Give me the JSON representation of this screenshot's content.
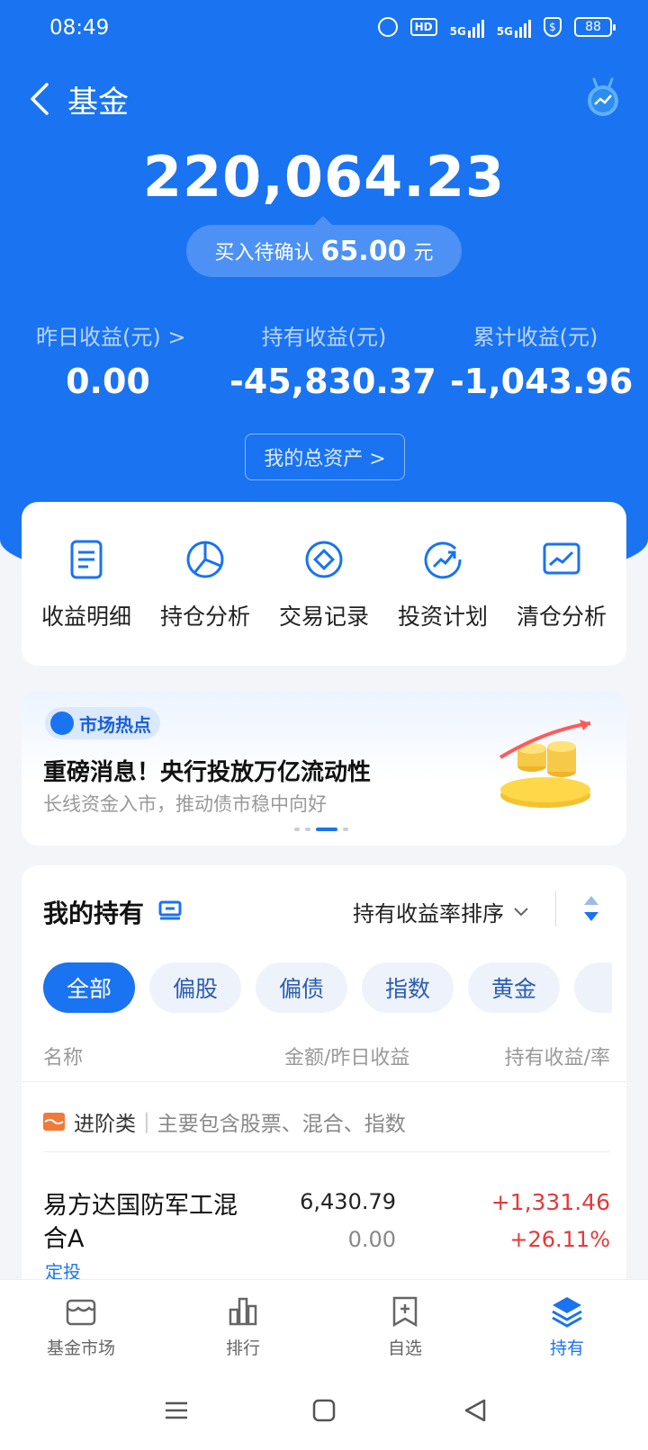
{
  "status_bar": {
    "time": "08:49",
    "network_1": "5G",
    "network_2": "5G",
    "hd_badge": "HD",
    "battery": "88"
  },
  "header": {
    "title": "基金"
  },
  "summary": {
    "total_amount": "220,064.23",
    "pending_label": "买入待确认",
    "pending_value": "65.00",
    "pending_unit": "元",
    "stats": [
      {
        "label": "昨日收益(元) >",
        "value": "0.00"
      },
      {
        "label": "持有收益(元)",
        "value": "-45,830.37"
      },
      {
        "label": "累计收益(元)",
        "value": "-1,043.96"
      }
    ],
    "assets_button": "我的总资产 >"
  },
  "quick_actions": [
    {
      "label": "收益明细",
      "icon": "document-icon"
    },
    {
      "label": "持仓分析",
      "icon": "pie-chart-icon"
    },
    {
      "label": "交易记录",
      "icon": "diamond-circle-icon"
    },
    {
      "label": "投资计划",
      "icon": "trend-circle-icon"
    },
    {
      "label": "清仓分析",
      "icon": "line-chart-icon"
    }
  ],
  "banner": {
    "tag": "市场热点",
    "title": "重磅消息！央行投放万亿流动性",
    "subtitle": "长线资金入市，推动债市稳中向好"
  },
  "holdings": {
    "title": "我的持有",
    "sort_label": "持有收益率排序",
    "filters": [
      "全部",
      "偏股",
      "偏债",
      "指数",
      "黄金",
      ""
    ],
    "active_filter": "全部",
    "columns": {
      "name": "名称",
      "amount": "金额/昨日收益",
      "profit": "持有收益/率"
    },
    "category": {
      "name": "进阶类",
      "desc": "主要包含股票、混合、指数"
    },
    "funds": [
      {
        "name": "易方达国防军工混合A",
        "tag": "定投",
        "amount": "6,430.79",
        "yesterday": "0.00",
        "profit": "+1,331.46",
        "rate": "+26.11%"
      }
    ]
  },
  "bottom_nav": [
    {
      "label": "基金市场",
      "icon": "store-icon"
    },
    {
      "label": "排行",
      "icon": "bar-chart-icon"
    },
    {
      "label": "自选",
      "icon": "bookmark-plus-icon"
    },
    {
      "label": "持有",
      "icon": "layers-icon",
      "active": true
    }
  ],
  "colors": {
    "brand_blue": "#1a73f0",
    "profit_red": "#e23a3a"
  }
}
